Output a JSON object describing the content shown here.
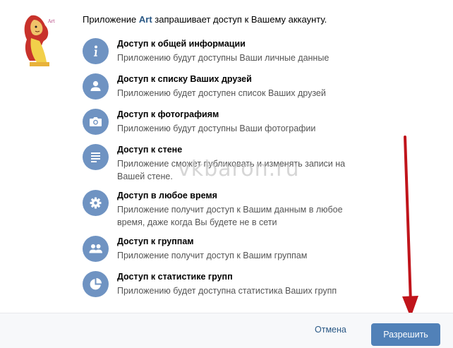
{
  "request": {
    "prefix": "Приложение",
    "app_name": "Art",
    "suffix": "запрашивает доступ к Вашему аккаунту."
  },
  "watermark": "vkbaron.ru",
  "permissions": [
    {
      "icon": "info-icon",
      "title": "Доступ к общей информации",
      "desc": "Приложению будут доступны Ваши личные данные"
    },
    {
      "icon": "person-icon",
      "title": "Доступ к списку Ваших друзей",
      "desc": "Приложению будет доступен список Ваших друзей"
    },
    {
      "icon": "camera-icon",
      "title": "Доступ к фотографиям",
      "desc": "Приложению будут доступны Ваши фотографии"
    },
    {
      "icon": "wall-lines-icon",
      "title": "Доступ к стене",
      "desc": "Приложение сможет публиковать и изменять записи на Вашей стене."
    },
    {
      "icon": "gear-icon",
      "title": "Доступ в любое время",
      "desc": "Приложение получит доступ к Вашим данным в любое время, даже когда Вы будете не в сети"
    },
    {
      "icon": "group-icon",
      "title": "Доступ к группам",
      "desc": "Приложение получит доступ к Вашим группам"
    },
    {
      "icon": "pie-chart-icon",
      "title": "Доступ к статистике групп",
      "desc": "Приложению будет доступна статистика Ваших групп"
    }
  ],
  "footer": {
    "cancel_label": "Отмена",
    "allow_label": "Разрешить"
  },
  "colors": {
    "icon_circle": "#6f93c2",
    "primary_button": "#5181b8",
    "link": "#2a5885",
    "arrow": "#c0141b"
  }
}
